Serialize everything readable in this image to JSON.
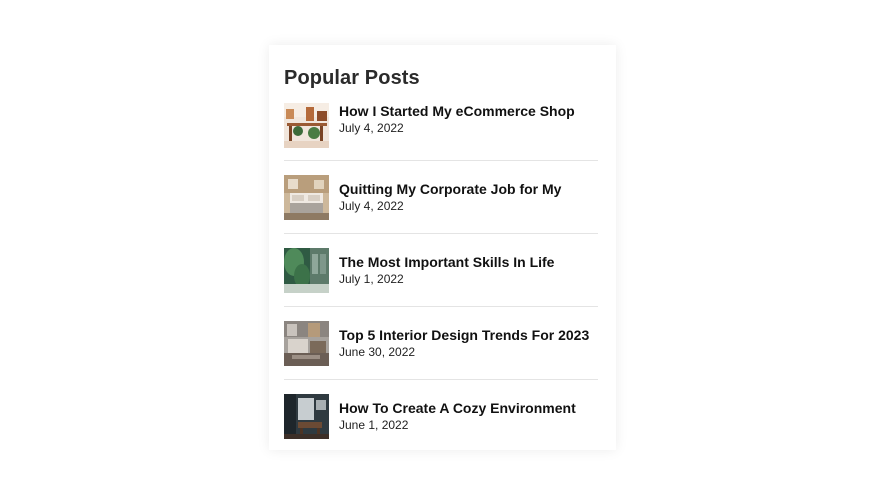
{
  "widget": {
    "title": "Popular Posts"
  },
  "posts": [
    {
      "title": "How I Started My eCommerce Shop",
      "date": "July 4, 2022",
      "thumbnail": "shop-interior-image"
    },
    {
      "title": "Quitting My Corporate Job for My",
      "date": "July 4, 2022",
      "thumbnail": "bedroom-image"
    },
    {
      "title": "The Most Important Skills In Life",
      "date": "July 1, 2022",
      "thumbnail": "plant-leaves-image"
    },
    {
      "title": "Top 5 Interior Design Trends For 2023",
      "date": "June 30, 2022",
      "thumbnail": "living-room-image"
    },
    {
      "title": "How To Create A Cozy Environment",
      "date": "June 1, 2022",
      "thumbnail": "cozy-room-image"
    }
  ]
}
